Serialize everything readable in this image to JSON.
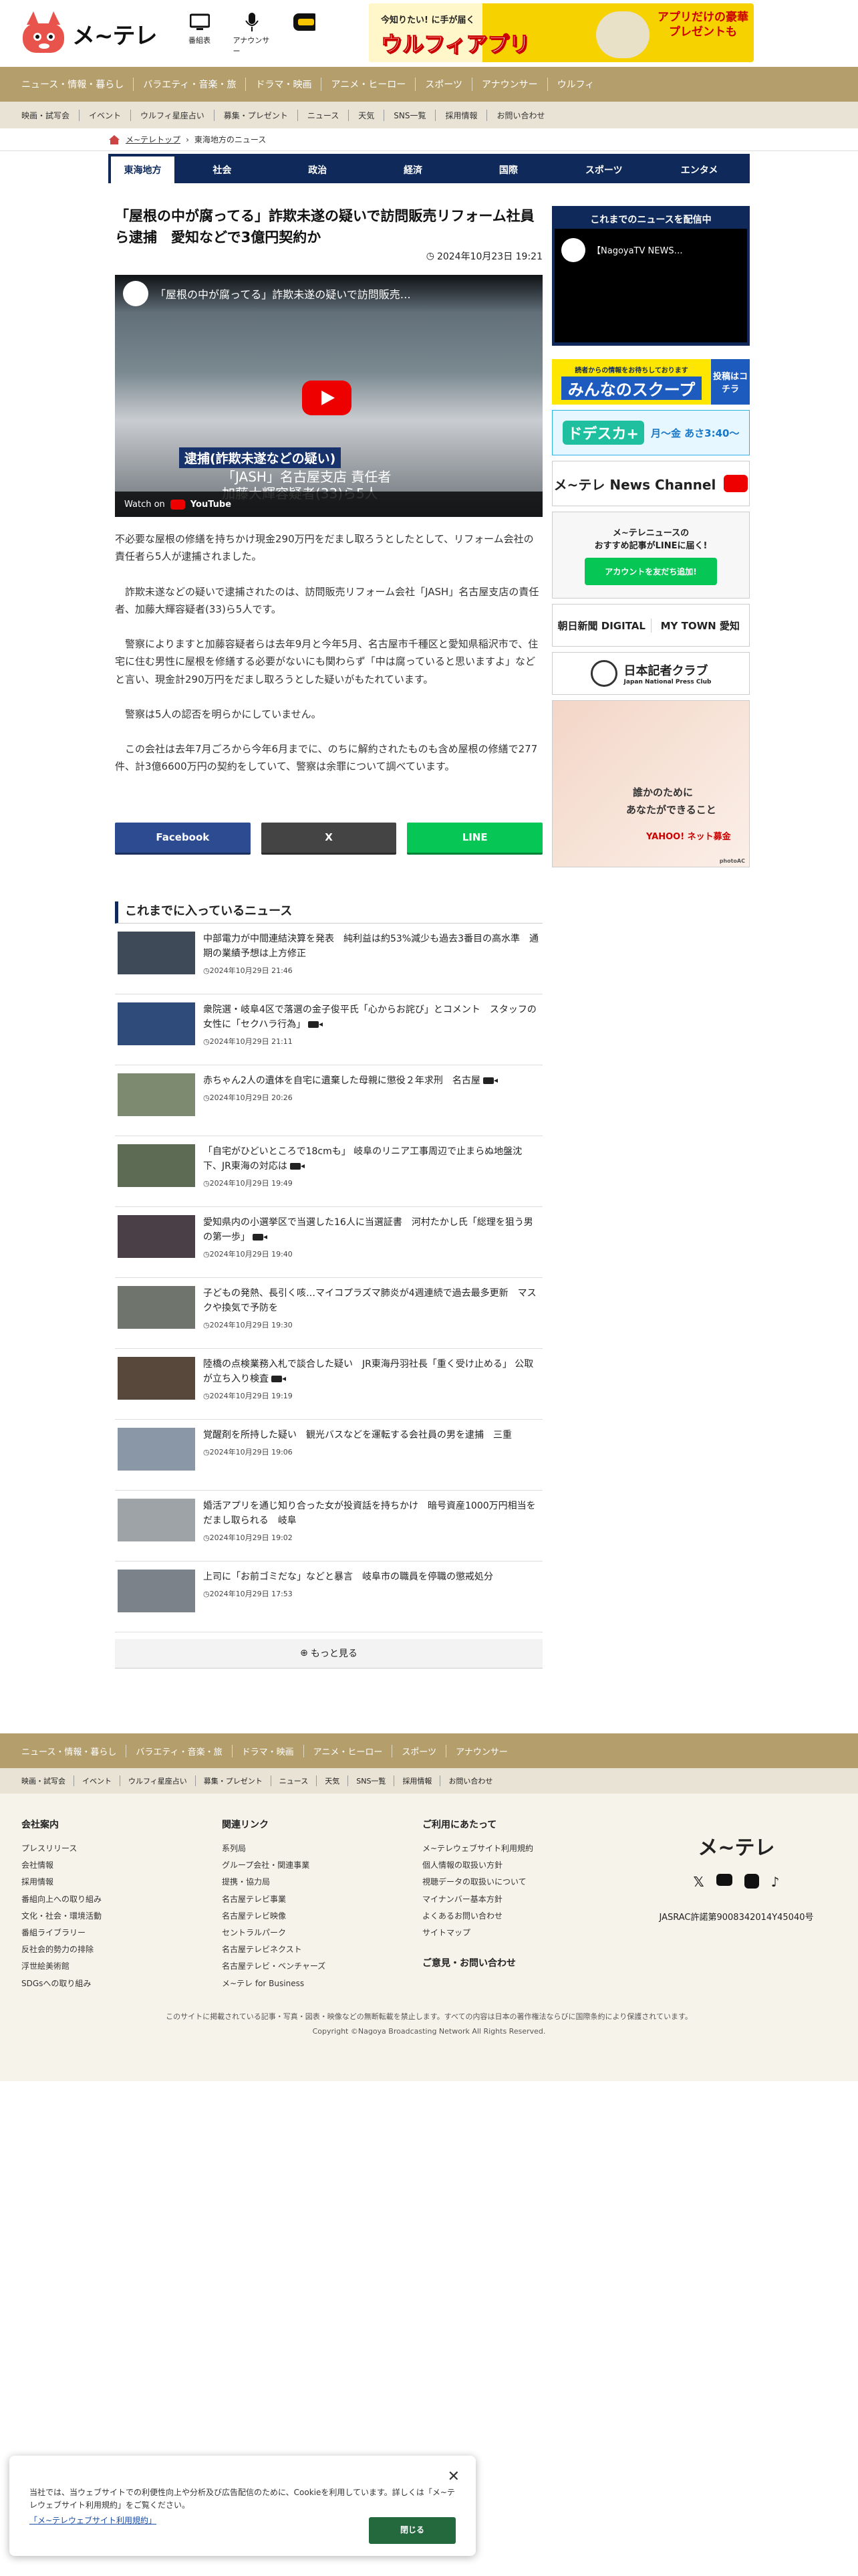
{
  "header": {
    "logo": "メ~テレ",
    "icons": [
      {
        "name": "tv-icon",
        "label": "番組表"
      },
      {
        "name": "mic-icon",
        "label": "アナウンサー"
      },
      {
        "name": "locipo-icon",
        "label": ""
      }
    ],
    "ad_text": "今知りたい! に手が届く",
    "ad_title": "ウルフィアプリ",
    "ad_badge": "アプリだけの豪華プレゼントも"
  },
  "nav_main": [
    "ニュース・情報・暮らし",
    "バラエティ・音楽・旅",
    "ドラマ・映画",
    "アニメ・ヒーロー",
    "スポーツ",
    "アナウンサー",
    "ウルフィ"
  ],
  "nav_sub": [
    "映画・試写会",
    "イベント",
    "ウルフィ星座占い",
    "募集・プレゼント",
    "ニュース",
    "天気",
    "SNS一覧",
    "採用情報",
    "お問い合わせ"
  ],
  "breadcrumb": [
    "メ~テレトップ",
    "東海地方のニュース"
  ],
  "tabs": [
    "東海地方",
    "社会",
    "政治",
    "経済",
    "国際",
    "スポーツ",
    "エンタメ"
  ],
  "article": {
    "title": "「屋根の中が腐ってる」詐欺未遂の疑いで訪問販売リフォーム社員ら逮捕　愛知などで3億円契約か",
    "date": "2024年10月23日 19:21",
    "video": {
      "title": "「屋根の中が腐ってる」詐欺未遂の疑いで訪問販売…",
      "caption1": "逮捕(詐欺未遂などの疑い)",
      "caption2": "「JASH」名古屋支店 責任者",
      "caption3": "加藤大輝容疑者(33)ら5人",
      "watch": "Watch on",
      "yt": "YouTube"
    },
    "paragraphs": [
      "不必要な屋根の修繕を持ちかけ現金290万円をだまし取ろうとしたとして、リフォーム会社の責任者ら5人が逮捕されました。",
      "　詐欺未遂などの疑いで逮捕されたのは、訪問販売リフォーム会社「JASH」名古屋支店の責任者、加藤大輝容疑者(33)ら5人です。",
      "　警察によりますと加藤容疑者らは去年9月と今年5月、名古屋市千種区と愛知県稲沢市で、住宅に住む男性に屋根を修繕する必要がないにも関わらず「中は腐っていると思いますよ」などと言い、現金計290万円をだまし取ろうとした疑いがもたれています。",
      "　警察は5人の認否を明らかにしていません。",
      "　この会社は去年7月ごろから今年6月までに、のちに解約されたものも含め屋根の修繕で277件、計3億6600万円の契約をしていて、警察は余罪について調べています。"
    ]
  },
  "share": {
    "facebook": "Facebook",
    "x": "X",
    "line": "LINE"
  },
  "news": {
    "heading": "これまでに入っているニュース",
    "items": [
      {
        "title": "中部電力が中間連結決算を発表　純利益は約53%減少も過去3番目の高水準　通期の業績予想は上方修正",
        "time": "2024年10月29日 21:46",
        "video": false
      },
      {
        "title": "衆院選・岐阜4区で落選の金子俊平氏「心からお詫び」とコメント　スタッフの女性に「セクハラ行為」",
        "time": "2024年10月29日 21:11",
        "video": true
      },
      {
        "title": "赤ちゃん2人の遺体を自宅に遺棄した母親に懲役２年求刑　名古屋",
        "time": "2024年10月29日 20:26",
        "video": true
      },
      {
        "title": "「自宅がひどいところで18cmも」 岐阜のリニア工事周辺で止まらぬ地盤沈下、JR東海の対応は",
        "time": "2024年10月29日 19:49",
        "video": true
      },
      {
        "title": "愛知県内の小選挙区で当選した16人に当選証書　河村たかし氏「総理を狙う男の第一歩」",
        "time": "2024年10月29日 19:40",
        "video": true
      },
      {
        "title": "子どもの発熱、長引く咳…マイコプラズマ肺炎が4週連続で過去最多更新　マスクや換気で予防を",
        "time": "2024年10月29日 19:30",
        "video": false
      },
      {
        "title": "陸橋の点検業務入札で談合した疑い　JR東海丹羽社長「重く受け止める」 公取が立ち入り検査",
        "time": "2024年10月29日 19:19",
        "video": true
      },
      {
        "title": "覚醒剤を所持した疑い　観光バスなどを運転する会社員の男を逮捕　三重",
        "time": "2024年10月29日 19:06",
        "video": false
      },
      {
        "title": "婚活アプリを通じ知り合った女が投資話を持ちかけ　暗号資産1000万円相当をだまし取られる　岐阜",
        "time": "2024年10月29日 19:02",
        "video": false
      },
      {
        "title": "上司に「お前ゴミだな」などと暴言　岐阜市の職員を停職の懲戒処分",
        "time": "2024年10月29日 17:53",
        "video": false
      }
    ],
    "more": "もっと見る"
  },
  "side": {
    "live_title": "これまでのニュースを配信中",
    "live_video": "【NagoyaTV NEWS…",
    "scoop_note": "読者からの情報をお待ちしております",
    "scoop": "みんなのスクープ",
    "scoop_btn": "投稿はコチラ",
    "doraska": "ドデスカ+",
    "doraska_time": "月〜金 あさ3:40〜",
    "channel": "メ~テレ News Channel",
    "line1": "メ~テレニュースの",
    "line2": "おすすめ記事がLINEに届く!",
    "line_btn": "アカウントを友だち追加!",
    "asahi": "朝日新聞 DIGITAL",
    "mytown": "MY TOWN 愛知",
    "kisha": "日本記者クラブ",
    "kisha_en": "Japan National Press Club",
    "yahoo1": "誰かのために",
    "yahoo2": "あなたができること",
    "yahoo_brand": "YAHOO! ネット募金",
    "photo": "photoAC"
  },
  "footer": {
    "nav_main": [
      "ニュース・情報・暮らし",
      "バラエティ・音楽・旅",
      "ドラマ・映画",
      "アニメ・ヒーロー",
      "スポーツ",
      "アナウンサー"
    ],
    "nav_sub": [
      "映画・試写会",
      "イベント",
      "ウルフィ星座占い",
      "募集・プレゼント",
      "ニュース",
      "天気",
      "SNS一覧",
      "採用情報",
      "お問い合わせ"
    ],
    "col1_title": "会社案内",
    "col1": [
      "プレスリリース",
      "会社情報",
      "採用情報",
      "番組向上への取り組み",
      "文化・社会・環境活動",
      "番組ライブラリー",
      "反社会的勢力の排除",
      "浮世絵美術館",
      "SDGsへの取り組み"
    ],
    "col2_title": "関連リンク",
    "col2": [
      "系列局",
      "グループ会社・関連事業",
      "提携・協力局",
      "名古屋テレビ事業",
      "名古屋テレビ映像",
      "セントラルパーク",
      "名古屋テレビネクスト",
      "名古屋テレビ・ベンチャーズ",
      "メ~テレ for Business"
    ],
    "col3_title": "ご利用にあたって",
    "col3": [
      "メ~テレウェブサイト利用規約",
      "個人情報の取扱い方針",
      "視聴データの取扱いについて",
      "マイナンバー基本方針",
      "よくあるお問い合わせ",
      "サイトマップ"
    ],
    "contact": "ご意見・お問い合わせ",
    "logo": "メ~テレ",
    "jasrac": "JASRAC許諾第9008342014Y45040号",
    "copy1": "このサイトに掲載されている記事・写真・図表・映像などの無断転載を禁止します。すべての内容は日本の著作権法ならびに国際条約により保護されています。",
    "copy2": "Copyright ©Nagoya Broadcasting Network All Rights Reserved."
  },
  "cookie": {
    "text1": "当社では、当ウェブサイトでの利便性向上や分析及び広告配信のために、Cookieを利用しています。詳しくは「メ~テレウェブサイト利用規約」をご覧ください。",
    "link": "「メ~テレウェブサイト利用規約」",
    "btn": "閉じる"
  }
}
